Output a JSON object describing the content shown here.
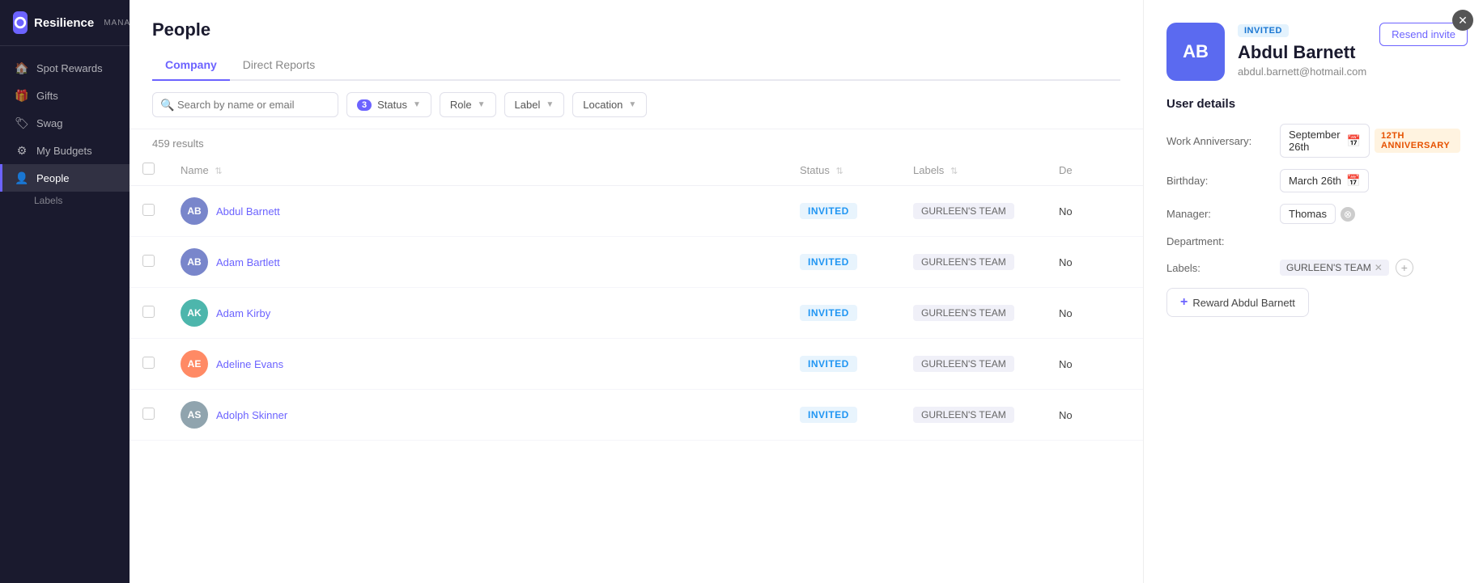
{
  "app": {
    "name": "Resilience",
    "role": "MANAGER"
  },
  "sidebar": {
    "items": [
      {
        "id": "spot-rewards",
        "label": "Spot Rewards",
        "icon": "🏠"
      },
      {
        "id": "gifts",
        "label": "Gifts",
        "icon": "🎁"
      },
      {
        "id": "swag",
        "label": "Swag",
        "icon": "🏷"
      },
      {
        "id": "my-budgets",
        "label": "My Budgets",
        "icon": "⚙"
      },
      {
        "id": "people",
        "label": "People",
        "icon": "👤",
        "active": true
      }
    ],
    "sub_items": [
      {
        "id": "labels",
        "label": "Labels"
      }
    ]
  },
  "page": {
    "title": "People",
    "tabs": [
      {
        "id": "company",
        "label": "Company",
        "active": true
      },
      {
        "id": "direct-reports",
        "label": "Direct Reports",
        "active": false
      }
    ]
  },
  "filters": {
    "search_placeholder": "Search by name or email",
    "status_label": "Status",
    "status_count": "3",
    "role_label": "Role",
    "label_label": "Label",
    "location_label": "Location"
  },
  "results": {
    "count": "459 results"
  },
  "table": {
    "headers": [
      "Name",
      "Status",
      "Labels",
      "De"
    ],
    "rows": [
      {
        "initials": "AB",
        "name": "Abdul Barnett",
        "status": "INVITED",
        "label": "GURLEEN'S TEAM",
        "dept": "No",
        "color": "#7986cb"
      },
      {
        "initials": "AB",
        "name": "Adam Bartlett",
        "status": "INVITED",
        "label": "GURLEEN'S TEAM",
        "dept": "No",
        "color": "#7986cb"
      },
      {
        "initials": "AK",
        "name": "Adam Kirby",
        "status": "INVITED",
        "label": "GURLEEN'S TEAM",
        "dept": "No",
        "color": "#4db6ac"
      },
      {
        "initials": "AE",
        "name": "Adeline Evans",
        "status": "INVITED",
        "label": "GURLEEN'S TEAM",
        "dept": "No",
        "color": "#ff8a65"
      },
      {
        "initials": "AS",
        "name": "Adolph Skinner",
        "status": "INVITED",
        "label": "GURLEEN'S TEAM",
        "dept": "No",
        "color": "#90a4ae"
      }
    ]
  },
  "detail": {
    "avatar_initials": "AB",
    "avatar_color": "#5b6af0",
    "invited_label": "INVITED",
    "resend_btn": "Resend invite",
    "name": "Abdul Barnett",
    "email": "abdul.barnett@hotmail.com",
    "section_title": "User details",
    "fields": {
      "work_anniversary_label": "Work Anniversary:",
      "work_anniversary_value": "September 26th",
      "anniversary_badge": "12TH ANNIVERSARY",
      "birthday_label": "Birthday:",
      "birthday_value": "March 26th",
      "manager_label": "Manager:",
      "manager_value": "Thomas",
      "department_label": "Department:",
      "department_value": "",
      "labels_label": "Labels:"
    },
    "label_tag": "GURLEEN'S TEAM",
    "reward_btn": "Reward Abdul Barnett"
  }
}
